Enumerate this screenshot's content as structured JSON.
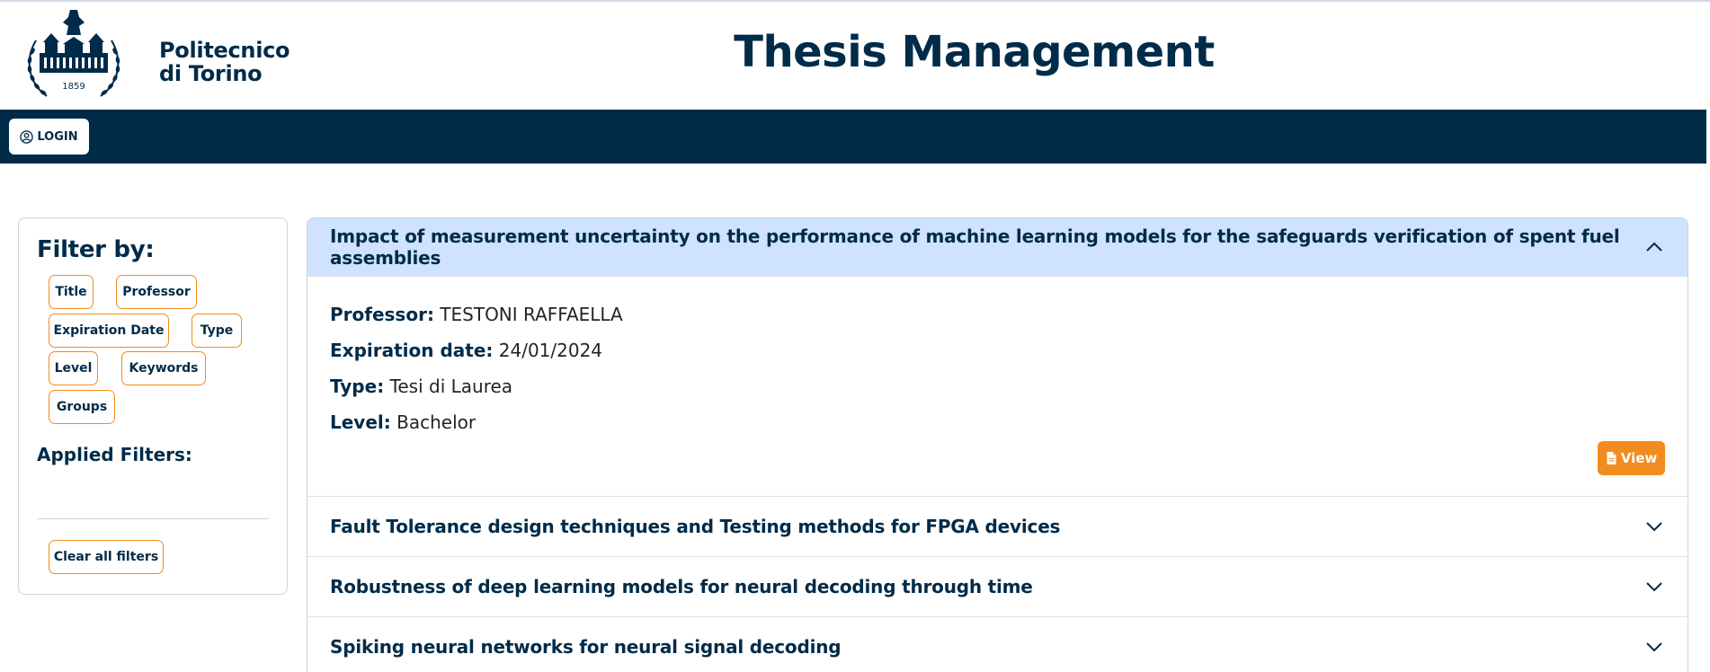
{
  "header": {
    "logo_text_line1": "Politecnico",
    "logo_text_line2": "di Torino",
    "logo_year": "1859",
    "title": "Thesis Management"
  },
  "nav": {
    "login_label": "LOGIN"
  },
  "sidebar": {
    "filter_heading": "Filter by:",
    "chips": [
      "Title",
      "Professor",
      "Expiration Date",
      "Type",
      "Level",
      "Keywords",
      "Groups"
    ],
    "applied_heading": "Applied Filters:",
    "clear_label": "Clear all filters"
  },
  "proposals": [
    {
      "title": "Impact of measurement uncertainty on the performance of machine learning models for the safeguards verification of spent fuel assemblies",
      "expanded": true,
      "professor_label": "Professor:",
      "professor": "TESTONI RAFFAELLA",
      "expiration_label": "Expiration date:",
      "expiration": "24/01/2024",
      "type_label": "Type:",
      "type": "Tesi di Laurea",
      "level_label": "Level:",
      "level": "Bachelor",
      "view_label": "View"
    },
    {
      "title": "Fault Tolerance design techniques and Testing methods for FPGA devices",
      "expanded": false
    },
    {
      "title": "Robustness of deep learning models for neural decoding through time",
      "expanded": false
    },
    {
      "title": "Spiking neural networks for neural signal decoding",
      "expanded": false
    }
  ],
  "colors": {
    "primary": "#002b49",
    "accent": "#f28c1e",
    "expanded_header": "#cfe2ff"
  }
}
